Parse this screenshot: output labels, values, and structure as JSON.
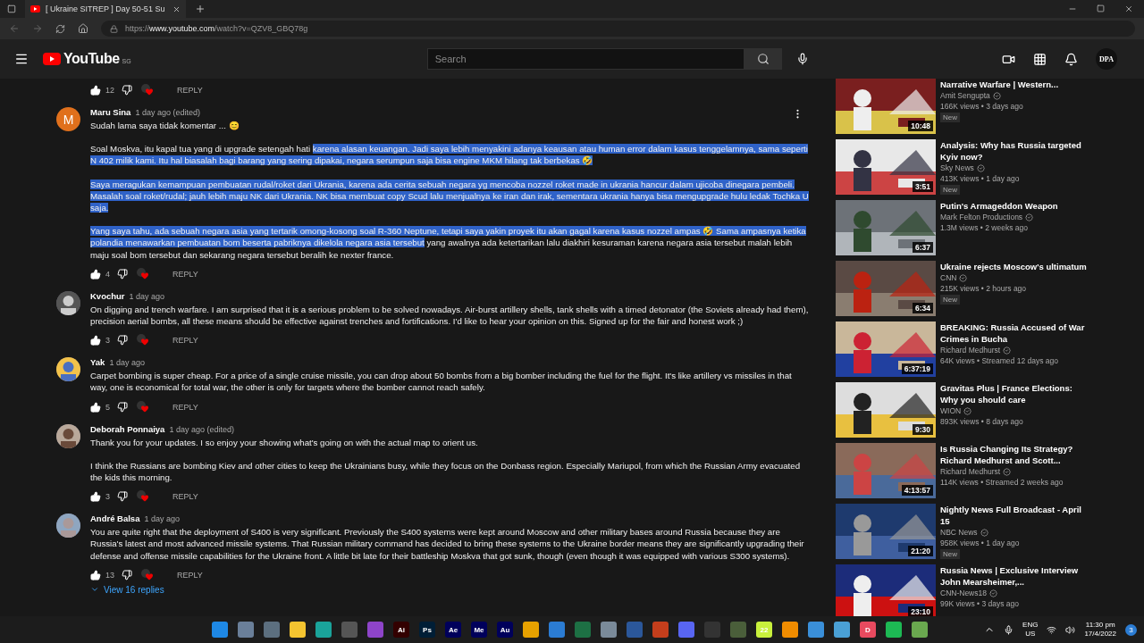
{
  "browser": {
    "tab_title": "[ Ukraine SITREP ] Day 50-51 Su",
    "url": "https://**www.youtube.com**/watch?v=QZV8_GBQ78g"
  },
  "header": {
    "logo": "YouTube",
    "region": "SG",
    "search_placeholder": "Search",
    "account": "DPA"
  },
  "prev_comment_actions": {
    "likes": "12",
    "reply": "REPLY"
  },
  "comments": [
    {
      "avatar_letter": "M",
      "author": "Maru Sina",
      "time": "1 day ago (edited)",
      "menu": true,
      "paragraphs": [
        [
          {
            "text": "Sudah lama saya tidak komentar ... 😊",
            "selected": false
          }
        ],
        [
          {
            "text": "Soal Moskva, itu kapal tua yang di upgrade setengah hati ",
            "selected": false
          },
          {
            "text": "karena alasan keuangan. Jadi saya lebih menyakini adanya keausan atau human error dalam kasus tenggelamnya, sama seperti N 402 milik kami.  Itu hal biasalah bagi barang yang sering dipakai, negara serumpun saja bisa engine MKM hilang tak berbekas 🤣",
            "selected": true
          }
        ],
        [
          {
            "text": "Saya meragukan kemampuan pembuatan rudal/roket dari Ukrania, karena ada cerita sebuah negara yg mencoba nozzel roket made in ukrania hancur dalam ujicoba dinegara pembeli. Masalah soal roket/rudal; jauh lebih maju NK dari Ukrania. NK bisa membuat copy Scud lalu menjualnya ke iran dan irak, sementara ukrania hanya bisa mengupgrade hulu ledak Tochka U saja.",
            "selected": true
          }
        ],
        [
          {
            "text": "Yang saya tahu, ada sebuah negara asia yang tertarik omong-kosong soal R-360 Neptune, tetapi saya yakin proyek itu akan gagal karena kasus nozzel ampas 🤣 Sama ampasnya ketika polandia menawarkan pembuatan bom beserta pabriknya dikelola negara asia tersebut",
            "selected": true
          },
          {
            "text": " yang awalnya ada ketertarikan lalu diakhiri kesuraman karena negara asia tersebut malah lebih maju soal bom tersebut dan sekarang negara tersebut beralih ke nexter france.",
            "selected": false
          }
        ]
      ],
      "likes": "4",
      "reply": "REPLY"
    },
    {
      "author": "Kvochur",
      "time": "1 day ago",
      "menu": false,
      "paragraphs": [
        [
          {
            "text": "On digging and trench warfare. I am surprised that it is a serious problem to be solved nowadays. Air-burst artillery shells, tank shells with a timed detonator (the Soviets already had them), precision aerial bombs, all these means should be effective against trenches and fortifications. I'd like to hear your opinion on this. Signed up for the fair and honest work ;)",
            "selected": false
          }
        ]
      ],
      "likes": "3",
      "reply": "REPLY"
    },
    {
      "author": "Yak",
      "time": "1 day ago",
      "menu": false,
      "paragraphs": [
        [
          {
            "text": "Carpet bombing is super cheap. For a price of a single cruise missile, you can drop about 50 bombs from a big bomber including the fuel for the flight. It's like artillery vs missiles in that way, one is economical for total war, the other is only for targets where the bomber cannot reach safely.",
            "selected": false
          }
        ]
      ],
      "likes": "5",
      "reply": "REPLY"
    },
    {
      "author": "Deborah Ponnaiya",
      "time": "1 day ago (edited)",
      "menu": false,
      "paragraphs": [
        [
          {
            "text": "Thank you for your updates. I so enjoy your showing what's going on with the actual map to orient us.",
            "selected": false
          }
        ],
        [
          {
            "text": "I think the Russians are bombing Kiev and other cities to keep the Ukrainians busy, while they focus on the Donbass region. Especially Mariupol, from which the Russian Army evacuated the kids this morning.",
            "selected": false
          }
        ]
      ],
      "likes": "3",
      "reply": "REPLY"
    },
    {
      "author": "André Balsa",
      "time": "1 day ago",
      "menu": false,
      "paragraphs": [
        [
          {
            "text": "You are quite right that the deployment of S400 is very significant. Previously the S400 systems were kept around Moscow and other military bases around Russia because they are Russia's latest and most advanced missile systems. That Russian military command has decided to bring these systems to the Ukraine border means they are significantly upgrading their defense and offense missile capabilities for the Ukraine front. A little bit late for their battleship Moskva that got sunk, though (even though it was equipped with various S300 systems).",
            "selected": false
          }
        ]
      ],
      "likes": "13",
      "reply": "REPLY",
      "replies": "View 16 replies"
    }
  ],
  "sidebar": [
    {
      "title": "Narrative Warfare | Western...",
      "channel": "Amit Sengupta",
      "stats": "166K views • 3 days ago",
      "duration": "10:48",
      "badge": "New"
    },
    {
      "title": "Analysis: Why has Russia targeted Kyiv now?",
      "channel": "Sky News",
      "stats": "413K views • 1 day ago",
      "duration": "3:51",
      "badge": "New"
    },
    {
      "title": "Putin's Armageddon Weapon",
      "channel": "Mark Felton Productions",
      "stats": "1.3M views • 2 weeks ago",
      "duration": "6:37"
    },
    {
      "title": "Ukraine rejects Moscow's ultimatum",
      "channel": "CNN",
      "stats": "215K views • 2 hours ago",
      "duration": "6:34",
      "badge": "New"
    },
    {
      "title": "BREAKING: Russia Accused of War Crimes in Bucha",
      "channel": "Richard Medhurst",
      "stats": "64K views • Streamed 12 days ago",
      "duration": "6:37:19"
    },
    {
      "title": "Gravitas Plus | France Elections: Why you should care",
      "channel": "WION",
      "stats": "893K views • 8 days ago",
      "duration": "9:30"
    },
    {
      "title": "Is Russia Changing Its Strategy? Richard Medhurst and Scott...",
      "channel": "Richard Medhurst",
      "stats": "114K views • Streamed 2 weeks ago",
      "duration": "4:13:57"
    },
    {
      "title": "Nightly News Full Broadcast - April 15",
      "channel": "NBC News",
      "stats": "958K views • 1 day ago",
      "duration": "21:20",
      "badge": "New"
    },
    {
      "title": "Russia News | Exclusive Interview John Mearsheimer,...",
      "channel": "CNN-News18",
      "stats": "99K views • 3 days ago",
      "duration": "23:10"
    }
  ],
  "taskbar": {
    "apps": [
      {
        "color": "#1e88e5"
      },
      {
        "color": "#6a7f99"
      },
      {
        "color": "#5c6f7f"
      },
      {
        "color": "#f4c430"
      },
      {
        "color": "#1aa39a"
      },
      {
        "color": "#555555"
      },
      {
        "color": "#8e44c9"
      },
      {
        "label": "Ai",
        "color": "#330000"
      },
      {
        "label": "Ps",
        "color": "#001e36"
      },
      {
        "label": "Ae",
        "color": "#00005b"
      },
      {
        "label": "Me",
        "color": "#00005b"
      },
      {
        "label": "Au",
        "color": "#00005b"
      },
      {
        "color": "#e6a100"
      },
      {
        "color": "#2b7cd3"
      },
      {
        "color": "#1d7044"
      },
      {
        "color": "#7a8a99"
      },
      {
        "color": "#2b579a"
      },
      {
        "color": "#c43e1c"
      },
      {
        "color": "#5865f2"
      },
      {
        "color": "#333333"
      },
      {
        "color": "#4a5e3a"
      },
      {
        "label": "22",
        "color": "#c8f03c"
      },
      {
        "color": "#f08c00"
      },
      {
        "color": "#3a8fd9"
      },
      {
        "color": "#4aa0d5"
      },
      {
        "label": "D",
        "color": "#e84a5f"
      },
      {
        "color": "#1db954"
      },
      {
        "color": "#6aa84f"
      }
    ],
    "lang": "ENG",
    "region": "US",
    "time": "11:30 pm",
    "date": "17/4/2022",
    "notifications": "3"
  }
}
